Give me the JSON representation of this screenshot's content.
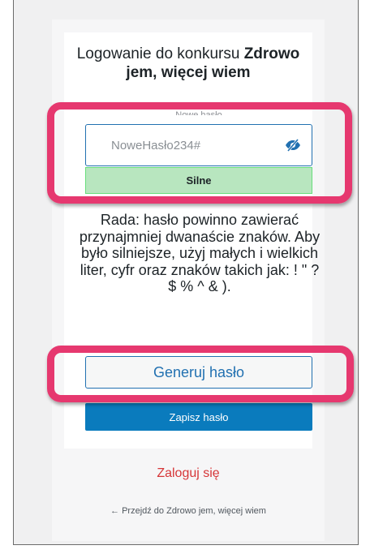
{
  "page": {
    "title_prefix": "Logowanie do konkursu ",
    "title_bold": "Zdrowo jem, więcej wiem"
  },
  "password": {
    "label": "Nowe hasło",
    "value": "NoweHasło234#",
    "strength": "Silne"
  },
  "hint": {
    "text": "Rada: hasło powinno zawierać przynajmniej dwanaście znaków. Aby było silniejsze, użyj małych i wielkich liter, cyfr oraz znaków takich jak: ! \" ? $ % ^ & )."
  },
  "buttons": {
    "generate": "Generuj hasło",
    "save": "Zapisz hasło"
  },
  "links": {
    "login": "Zaloguj się",
    "back": "← Przejdź do Zdrowo jem, więcej wiem"
  },
  "colors": {
    "highlight": "#e6386f",
    "primary": "#0a7bbd",
    "strength_bg": "#b8e6bf",
    "link_red": "#d63638"
  },
  "icons": {
    "visibility_toggle": "eye-slash-icon"
  }
}
